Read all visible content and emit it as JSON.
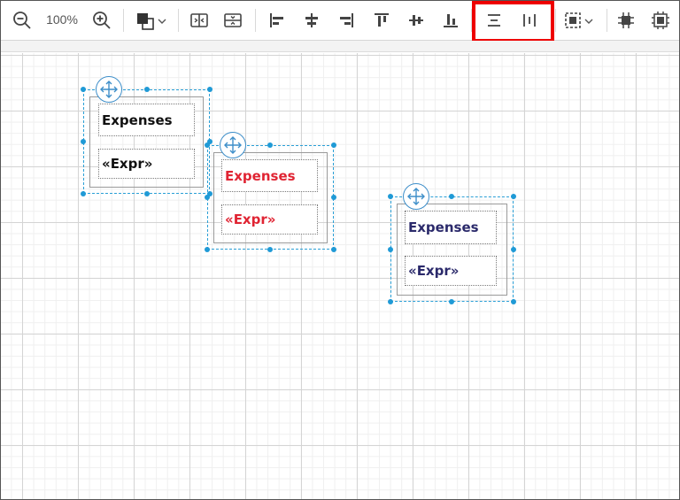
{
  "toolbar": {
    "zoom_level": "100%",
    "zoom_out_icon": "zoom-out-icon",
    "zoom_in_icon": "zoom-in-icon",
    "fill_color_icon": "fill-color-icon",
    "icons": [
      "distribute-horizontal-icon",
      "distribute-vertical-icon",
      "align-left-icon",
      "align-center-icon",
      "align-right-icon",
      "align-top-icon",
      "align-middle-icon",
      "align-bottom-icon",
      "same-width-icon",
      "same-height-icon",
      "group-select-icon",
      "bring-to-front-icon",
      "send-to-back-icon"
    ],
    "highlight_color": "#ee0000"
  },
  "canvas": {
    "groups": [
      {
        "label_text": "Expenses",
        "expr_text": "«Expr»",
        "text_color": "#111111"
      },
      {
        "label_text": "Expenses",
        "expr_text": "«Expr»",
        "text_color": "#e02433"
      },
      {
        "label_text": "Expenses",
        "expr_text": "«Expr»",
        "text_color": "#2b2a6b"
      }
    ],
    "selection_color": "#2a9fd6"
  }
}
